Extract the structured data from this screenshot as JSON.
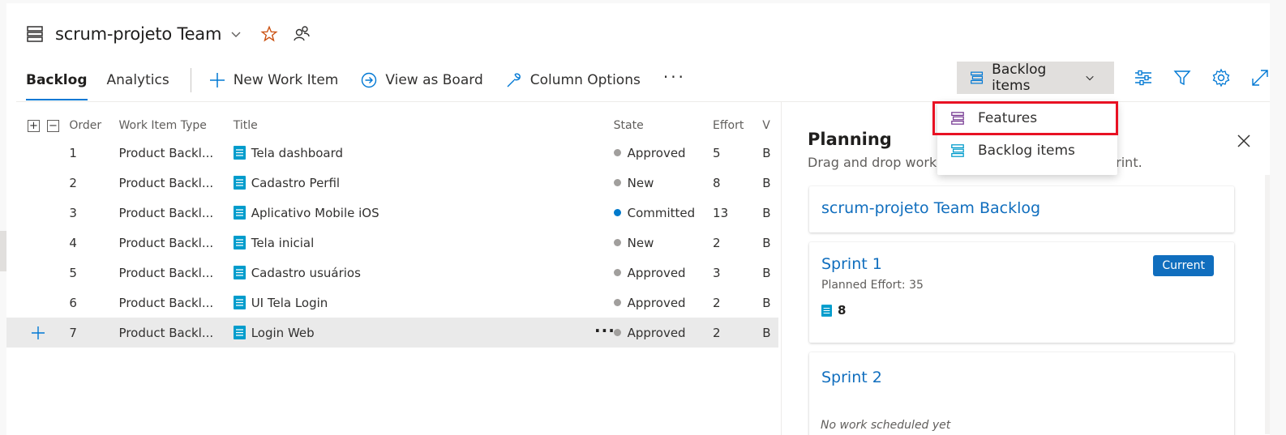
{
  "header": {
    "team_name": "scrum-projeto Team"
  },
  "toolbar": {
    "tabs": [
      {
        "label": "Backlog",
        "active": true
      },
      {
        "label": "Analytics",
        "active": false
      }
    ],
    "new_work_item": "New Work Item",
    "view_as_board": "View as Board",
    "column_options": "Column Options",
    "more": "···"
  },
  "backlog_selector": {
    "label": "Backlog items",
    "options": [
      "Features",
      "Backlog items"
    ],
    "highlighted_option": "Features"
  },
  "grid": {
    "columns": [
      "Order",
      "Work Item Type",
      "Title",
      "State",
      "Effort",
      "V"
    ],
    "rows": [
      {
        "order": "1",
        "type": "Product Backl...",
        "title": "Tela dashboard",
        "state": "Approved",
        "effort": "5",
        "v": "B"
      },
      {
        "order": "2",
        "type": "Product Backl...",
        "title": "Cadastro Perfil",
        "state": "New",
        "effort": "8",
        "v": "B"
      },
      {
        "order": "3",
        "type": "Product Backl...",
        "title": "Aplicativo Mobile iOS",
        "state": "Committed",
        "effort": "13",
        "v": "B"
      },
      {
        "order": "4",
        "type": "Product Backl...",
        "title": "Tela inicial",
        "state": "New",
        "effort": "2",
        "v": "B"
      },
      {
        "order": "5",
        "type": "Product Backl...",
        "title": "Cadastro usuários",
        "state": "Approved",
        "effort": "3",
        "v": "B"
      },
      {
        "order": "6",
        "type": "Product Backl...",
        "title": "UI Tela Login",
        "state": "Approved",
        "effort": "2",
        "v": "B"
      },
      {
        "order": "7",
        "type": "Product Backl...",
        "title": "Login Web",
        "state": "Approved",
        "effort": "2",
        "v": "B"
      }
    ],
    "state_colors": {
      "Approved": "#a19f9d",
      "New": "#a19f9d",
      "Committed": "#007acc"
    }
  },
  "planning": {
    "title": "Planning",
    "subtitle_start": "Drag and drop work",
    "subtitle_end": "print.",
    "cards": {
      "backlog": "scrum-projeto Team Backlog",
      "sprint1": {
        "name": "Sprint 1",
        "badge": "Current",
        "planned_effort": "Planned Effort: 35",
        "count": "8"
      },
      "sprint2": {
        "name": "Sprint 2",
        "empty_text": "No work scheduled yet"
      }
    }
  },
  "colors": {
    "accent": "#0078d4",
    "link": "#106ebe",
    "highlight_box": "#e81123",
    "work_item_icon": "#009ccc"
  }
}
